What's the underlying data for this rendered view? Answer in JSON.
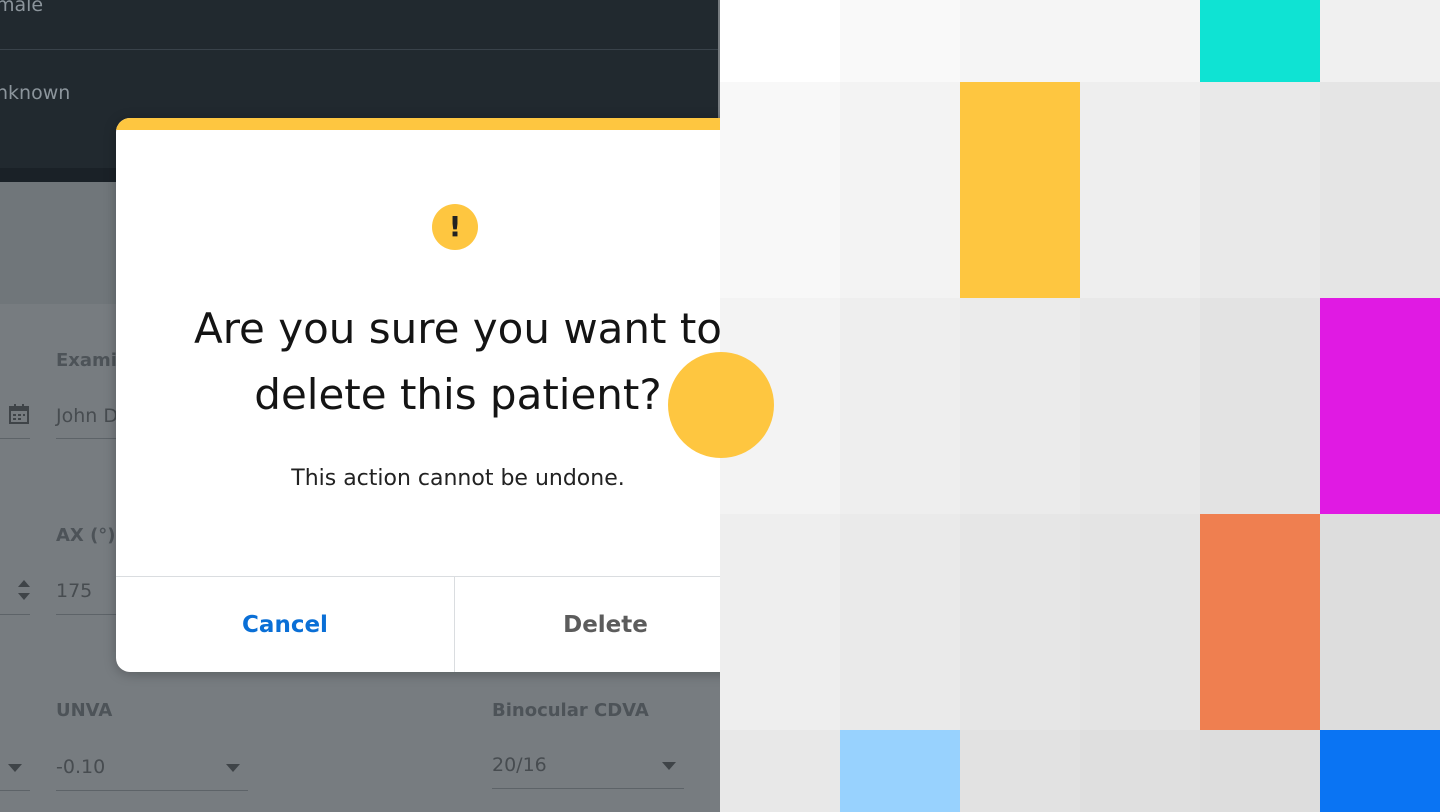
{
  "dropdown": {
    "options": [
      "male",
      "nknown"
    ]
  },
  "form": {
    "examiner": {
      "label": "Exami",
      "value": "John  D"
    },
    "ax": {
      "label": "AX (°)",
      "value": "175"
    },
    "unva": {
      "label": "UNVA",
      "value": "-0.10"
    },
    "binocular_cdva": {
      "label": "Binocular CDVA",
      "value": "20/16"
    }
  },
  "dialog": {
    "icon": "!",
    "title_line1": "Are you sure you want to",
    "title_line2": "delete this patient?",
    "subtitle": "This action cannot be undone.",
    "cancel_label": "Cancel",
    "delete_label": "Delete"
  },
  "colors": {
    "accent_yellow": "#fec640",
    "link_blue": "#0a6fd6",
    "dark_panel": "#21292f",
    "overlay_gray": "#777c80",
    "teal": "#0fe3d3",
    "magenta": "#e01ae3",
    "orange": "#ef7f50",
    "light_blue": "#98d2fe",
    "blue": "#0a74f3"
  },
  "pixel_grid": {
    "columns": 6,
    "row_breaks": [
      0,
      82,
      298,
      514,
      730,
      812
    ],
    "rows": [
      [
        "#ffffff",
        "#f9f9f9",
        "#f5f5f5",
        "#f5f5f5",
        "#0fe3d3",
        "#f0f0f0"
      ],
      [
        "#f8f8f8",
        "#f3f3f3",
        "#fec640",
        "#eeeeee",
        "#e9e9e9",
        "#e5e5e5"
      ],
      [
        "#f3f3f3",
        "#eeeeee",
        "#ebebeb",
        "#e8e8e8",
        "#e3e3e3",
        "#e01ae3"
      ],
      [
        "#eeeeee",
        "#eaeaea",
        "#e6e6e6",
        "#e4e4e4",
        "#ef7f50",
        "#dddddd"
      ],
      [
        "#e8e8e8",
        "#98d2fe",
        "#e2e2e2",
        "#dfdfdf",
        "#dddddd",
        "#0a74f3"
      ]
    ]
  }
}
